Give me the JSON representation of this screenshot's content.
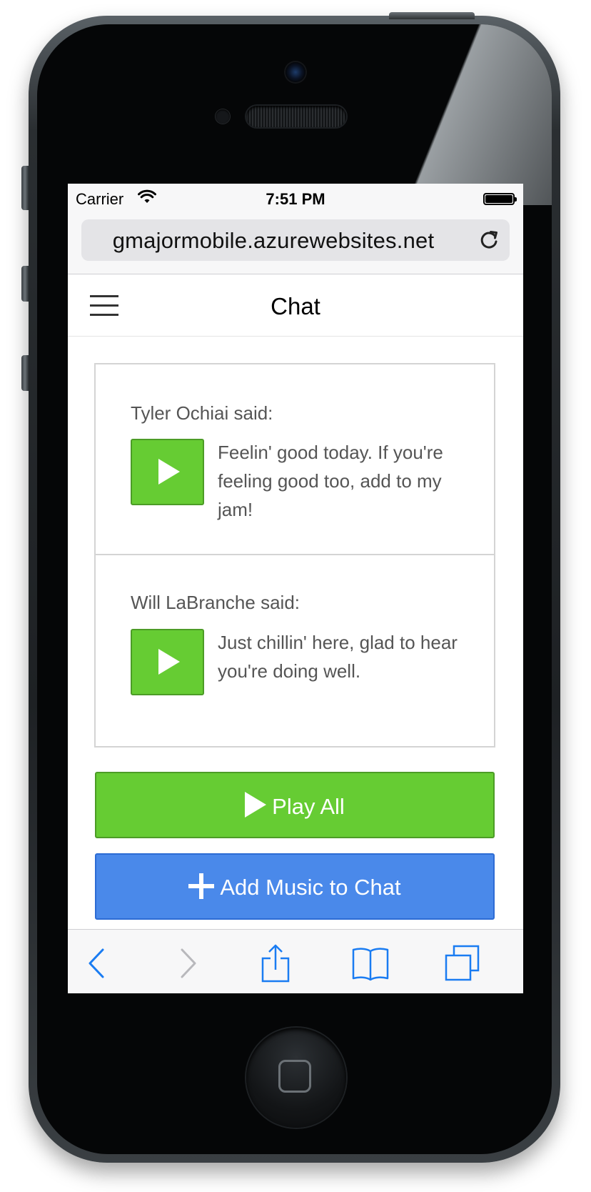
{
  "status_bar": {
    "carrier": "Carrier",
    "time": "7:51 PM"
  },
  "browser": {
    "url": "gmajormobile.azurewebsites.net"
  },
  "header": {
    "title": "Chat"
  },
  "messages": [
    {
      "author": "Tyler Ochiai said:",
      "text": "Feelin' good today. If you're feeling good too, add to my jam!"
    },
    {
      "author": "Will LaBranche said:",
      "text": "Just chillin' here, glad to hear you're doing well."
    }
  ],
  "actions": {
    "play_all": "Play All",
    "add_music": "Add Music to Chat"
  },
  "toolbar": {
    "items": [
      "back-icon",
      "forward-icon",
      "share-icon",
      "bookmarks-icon",
      "tabs-icon"
    ]
  },
  "colors": {
    "green": "#66cc33",
    "blue": "#4a89ea",
    "ios_blue": "#1a7cf2"
  }
}
